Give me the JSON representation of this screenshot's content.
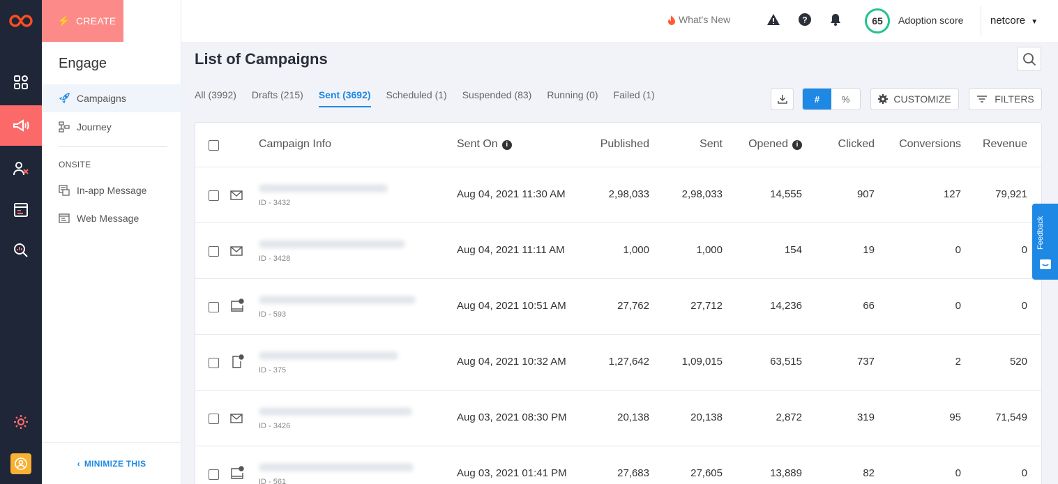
{
  "nav": {
    "create_label": "CREATE",
    "minimize_label": "MINIMIZE THIS"
  },
  "sidebar": {
    "title": "Engage",
    "items": [
      {
        "label": "Campaigns"
      },
      {
        "label": "Journey"
      }
    ],
    "onsite_heading": "ONSITE",
    "onsite_items": [
      {
        "label": "In-app Message"
      },
      {
        "label": "Web Message"
      }
    ]
  },
  "topbar": {
    "whats_new": "What's New",
    "adoption_score": "65",
    "adoption_label": "Adoption score",
    "user_name": "netcore"
  },
  "main": {
    "title": "List of Campaigns",
    "tabs": [
      {
        "label": "All (3992)"
      },
      {
        "label": "Drafts (215)"
      },
      {
        "label": "Sent (3692)",
        "active": true
      },
      {
        "label": "Scheduled (1)"
      },
      {
        "label": "Suspended (83)"
      },
      {
        "label": "Running (0)"
      },
      {
        "label": "Failed (1)"
      }
    ],
    "toggle": {
      "count_label": "#",
      "percent_label": "%"
    },
    "customize_label": "CUSTOMIZE",
    "filters_label": "FILTERS"
  },
  "table": {
    "columns": {
      "campaign_info": "Campaign Info",
      "sent_on": "Sent On",
      "published": "Published",
      "sent": "Sent",
      "opened": "Opened",
      "clicked": "Clicked",
      "conversions": "Conversions",
      "revenue": "Revenue"
    },
    "rows": [
      {
        "channel": "email",
        "id": "ID - 3432",
        "sent_on": "Aug 04, 2021 11:30 AM",
        "published": "2,98,033",
        "sent": "2,98,033",
        "opened": "14,555",
        "clicked": "907",
        "conversions": "127",
        "revenue": "79,921"
      },
      {
        "channel": "email",
        "id": "ID - 3428",
        "sent_on": "Aug 04, 2021 11:11 AM",
        "published": "1,000",
        "sent": "1,000",
        "opened": "154",
        "clicked": "19",
        "conversions": "0",
        "revenue": "0"
      },
      {
        "channel": "web-push",
        "id": "ID - 593",
        "sent_on": "Aug 04, 2021 10:51 AM",
        "published": "27,762",
        "sent": "27,712",
        "opened": "14,236",
        "clicked": "66",
        "conversions": "0",
        "revenue": "0"
      },
      {
        "channel": "app-push",
        "id": "ID - 375",
        "sent_on": "Aug 04, 2021 10:32 AM",
        "published": "1,27,642",
        "sent": "1,09,015",
        "opened": "63,515",
        "clicked": "737",
        "conversions": "2",
        "revenue": "520"
      },
      {
        "channel": "email",
        "id": "ID - 3426",
        "sent_on": "Aug 03, 2021 08:30 PM",
        "published": "20,138",
        "sent": "20,138",
        "opened": "2,872",
        "clicked": "319",
        "conversions": "95",
        "revenue": "71,549"
      },
      {
        "channel": "web-push",
        "id": "ID - 561",
        "sent_on": "Aug 03, 2021 01:41 PM",
        "published": "27,683",
        "sent": "27,605",
        "opened": "13,889",
        "clicked": "82",
        "conversions": "0",
        "revenue": "0"
      }
    ]
  },
  "feedback_label": "Feedback",
  "colors": {
    "accent": "#1e88e5",
    "rail": "#1f2638",
    "create": "#fb8a88",
    "active_rail": "#fb6a68",
    "score_ring": "#22c38e"
  }
}
